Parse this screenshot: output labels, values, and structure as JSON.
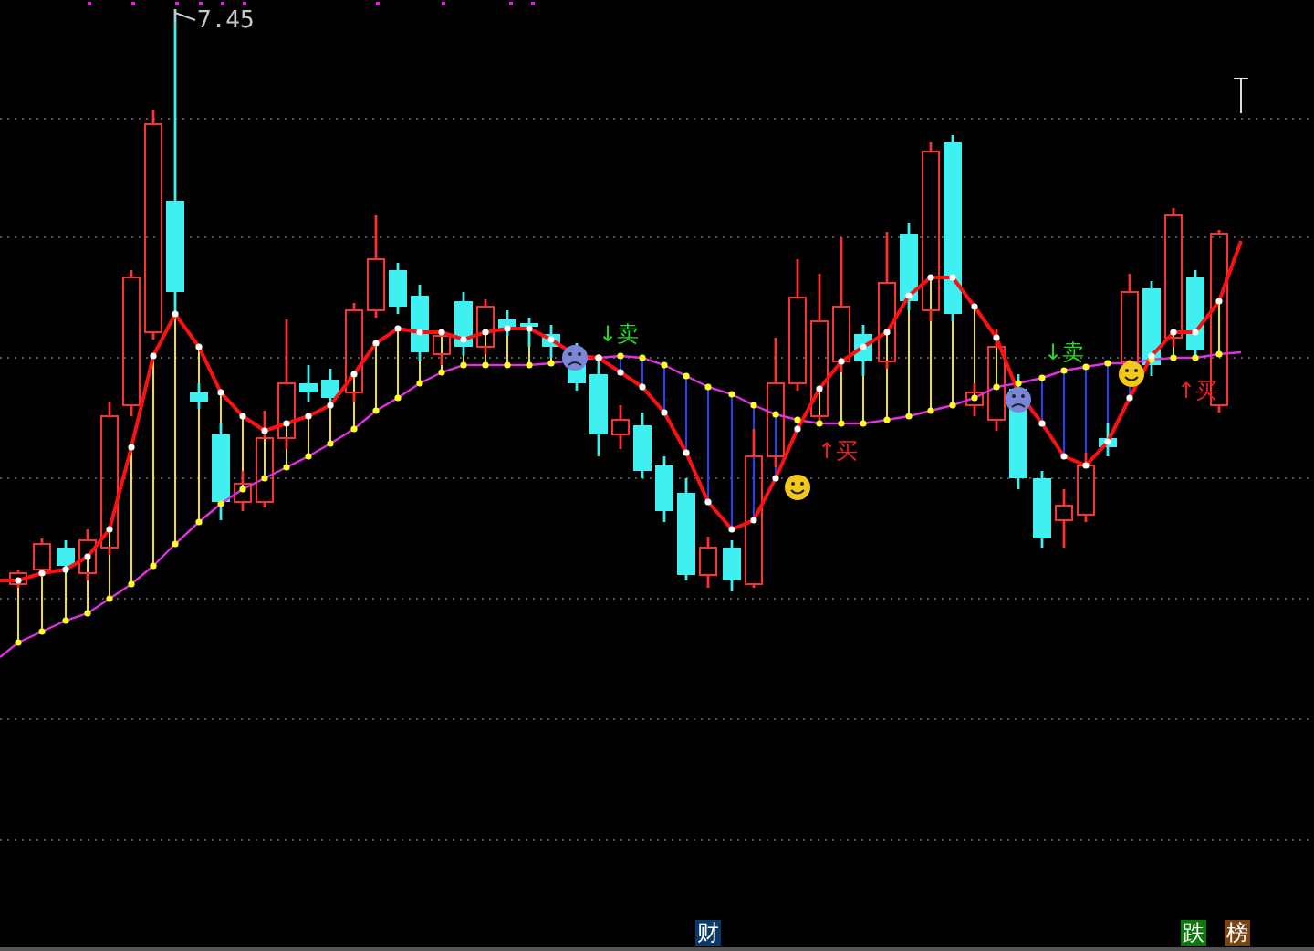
{
  "price_label": {
    "text": "7.45"
  },
  "signals": [
    {
      "kind": "sell",
      "text": "↓卖"
    },
    {
      "kind": "buy",
      "text": "↑买"
    },
    {
      "kind": "sell",
      "text": "↓卖"
    },
    {
      "kind": "buy",
      "text": "↑买"
    }
  ],
  "badges": [
    {
      "text": "财",
      "color": "#0b3a6a"
    },
    {
      "text": "跌",
      "color": "#0b7a0b"
    },
    {
      "text": "榜",
      "color": "#7a4410"
    }
  ]
}
